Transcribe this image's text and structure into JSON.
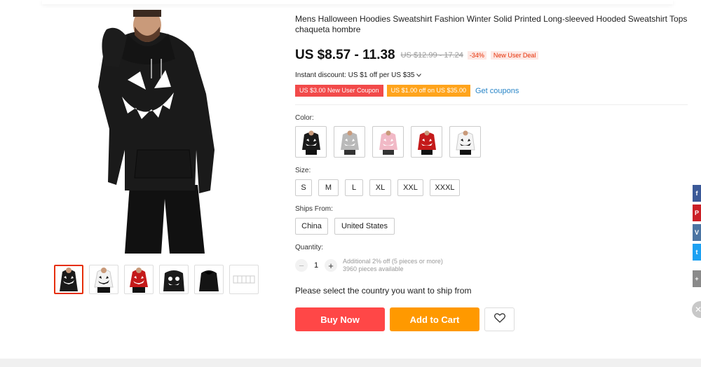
{
  "product": {
    "title": "Mens Halloween Hoodies Sweatshirt Fashion Winter Solid Printed Long-sleeved Hooded Sweatshirt Tops chaqueta hombre",
    "price": "US $8.57 - 11.38",
    "old_price": "US $12.99 - 17.24",
    "discount": "-34%",
    "deal_badge": "New User Deal",
    "instant_discount": "Instant discount: US $1 off per US $35",
    "coupons": [
      {
        "label": "US $3.00 New User Coupon",
        "color": "#f24a4a"
      },
      {
        "label": "US $1.00 off on US $35.00",
        "color": "#ffa41c"
      }
    ],
    "get_coupons": "Get coupons"
  },
  "options": {
    "color_label": "Color:",
    "colors": [
      "black",
      "gray",
      "pink",
      "red",
      "white"
    ],
    "size_label": "Size:",
    "sizes": [
      "S",
      "M",
      "L",
      "XL",
      "XXL",
      "XXXL"
    ],
    "ships_from_label": "Ships From:",
    "ships_from": [
      "China",
      "United States"
    ]
  },
  "quantity": {
    "label": "Quantity:",
    "minus": "−",
    "value": "1",
    "plus": "+",
    "note_line1": "Additional 2% off (5 pieces or more)",
    "note_line2": "3960 pieces available"
  },
  "ship_message": "Please select the country you want to ship from",
  "actions": {
    "buy_now": "Buy Now",
    "add_to_cart": "Add to Cart"
  },
  "gallery": {
    "thumbnails": [
      "black-pumpkin",
      "white-pumpkin",
      "red-pumpkin",
      "black-skull",
      "black-plain",
      "size-chart"
    ],
    "active_index": 0
  },
  "social": [
    {
      "icon": "facebook-icon",
      "glyph": "f",
      "color": "#3b5998"
    },
    {
      "icon": "pinterest-icon",
      "glyph": "P",
      "color": "#cb2027"
    },
    {
      "icon": "vk-icon",
      "glyph": "V",
      "color": "#4c75a3"
    },
    {
      "icon": "twitter-icon",
      "glyph": "t",
      "color": "#1da1f2"
    },
    {
      "icon": "more-share-icon",
      "glyph": "+",
      "color": "#8a8a8a"
    }
  ],
  "colors": {
    "buy_now": "#ff4747",
    "add_to_cart": "#ff9900",
    "thumb_active": "#e62e04",
    "link": "#2a86c8"
  }
}
